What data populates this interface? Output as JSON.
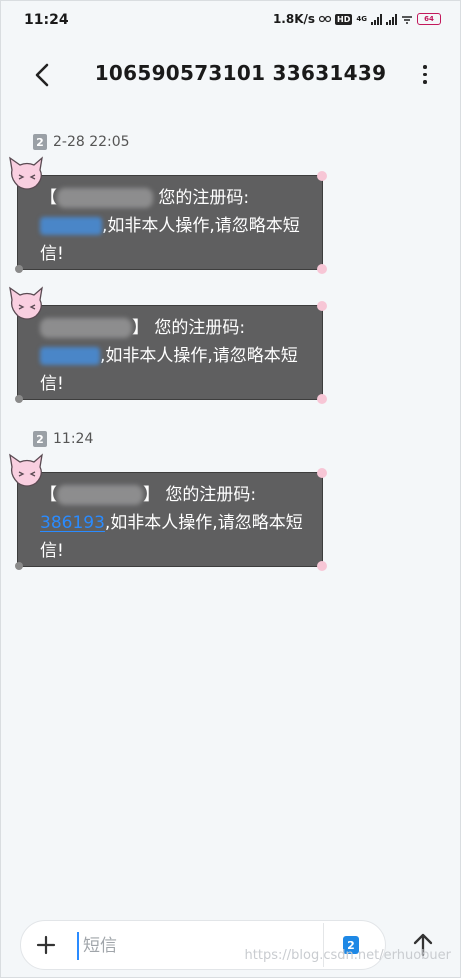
{
  "status_bar": {
    "time": "11:24",
    "network_speed": "1.8K/s",
    "hd": "HD",
    "network_type": "4G",
    "battery": "64"
  },
  "header": {
    "title": "106590573101 33631439"
  },
  "conversation": {
    "groups": [
      {
        "sim": "2",
        "timestamp": "2-28 22:05",
        "messages": [
          {
            "bracket_open": "【",
            "bracket_close": "",
            "text_after_name": "您的注册码:",
            "text_after_code": ",如非本人操作,请忽略本短信!"
          },
          {
            "bracket_open": "",
            "bracket_close": "】",
            "text_after_name": "您的注册码:",
            "text_after_code": ",如非本人操作,请忽略本短信!"
          }
        ]
      },
      {
        "sim": "2",
        "timestamp": "11:24",
        "messages": [
          {
            "bracket_open": "【",
            "bracket_close": "】",
            "text_after_name": "您的注册码:",
            "code": "386193",
            "text_after_code": ",如非本人操作,请忽略本短信!"
          }
        ]
      }
    ]
  },
  "composer": {
    "placeholder": "短信",
    "sim": "2"
  },
  "watermark": "https://blog.csdn.net/erhuobuer",
  "colors": {
    "bubble": "#5f5f60",
    "link": "#2a8bff",
    "background": "#f4f7f9"
  }
}
